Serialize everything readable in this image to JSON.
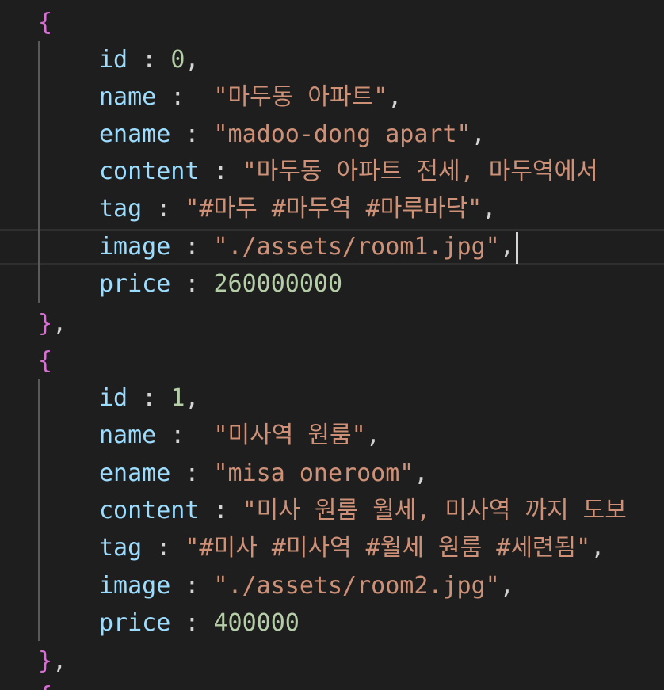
{
  "editor": {
    "lines": {
      "l1": {
        "open": "{"
      },
      "l2": {
        "key": "id",
        "sep": " : ",
        "val": "0",
        "tail": ","
      },
      "l3": {
        "key": "name",
        "sep": " :  ",
        "val": "\"마두동 아파트\"",
        "tail": ","
      },
      "l4": {
        "key": "ename",
        "sep": " : ",
        "val": "\"madoo-dong apart\"",
        "tail": ","
      },
      "l5": {
        "key": "content",
        "sep": " : ",
        "val": "\"마두동 아파트 전세, 마두역에서"
      },
      "l6": {
        "key": "tag",
        "sep": " : ",
        "val": "\"#마두 #마두역 #마루바닥\"",
        "tail": ","
      },
      "l7": {
        "key": "image",
        "sep": " : ",
        "val": "\"./assets/room1.jpg\"",
        "tail": ","
      },
      "l8": {
        "key": "price",
        "sep": " : ",
        "val": "260000000"
      },
      "l9": {
        "close": "}",
        "tail": ","
      },
      "l10": {
        "open": "{"
      },
      "l11": {
        "key": "id",
        "sep": " : ",
        "val": "1",
        "tail": ","
      },
      "l12": {
        "key": "name",
        "sep": " :  ",
        "val": "\"미사역 원룸\"",
        "tail": ","
      },
      "l13": {
        "key": "ename",
        "sep": " : ",
        "val": "\"misa oneroom\"",
        "tail": ","
      },
      "l14": {
        "key": "content",
        "sep": " : ",
        "val": "\"미사 원룸 월세, 미사역 까지 도보"
      },
      "l15": {
        "key": "tag",
        "sep": " : ",
        "val": "\"#미사 #미사역 #월세 원룸 #세련됨\"",
        "tail": ","
      },
      "l16": {
        "key": "image",
        "sep": " : ",
        "val": "\"./assets/room2.jpg\"",
        "tail": ","
      },
      "l17": {
        "key": "price",
        "sep": " : ",
        "val": "400000"
      },
      "l18": {
        "close": "}",
        "tail": ","
      },
      "l19": {
        "open": "{"
      }
    }
  },
  "colors": {
    "background": "#1e1e1e",
    "brace": "#da70d6",
    "key": "#9cdcfe",
    "string": "#ce9178",
    "number": "#b5cea8",
    "punctuation": "#d4d4d4"
  }
}
